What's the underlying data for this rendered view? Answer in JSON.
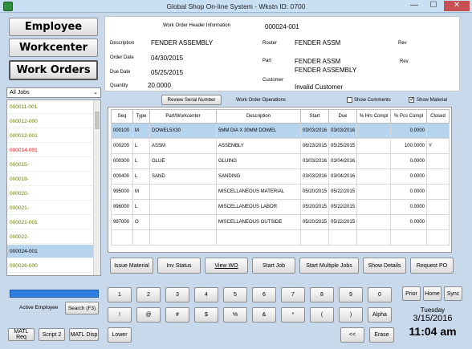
{
  "window": {
    "title": "Global Shop On-line System - Wkstn ID: 0700",
    "min": "—",
    "max": "☐",
    "close": "✕"
  },
  "nav": {
    "employee": "Employee",
    "workcenter": "Workcenter",
    "work_orders": "Work Orders"
  },
  "jobs": {
    "filter": "All Jobs",
    "items": [
      {
        "id": "000011-001",
        "color": "#6a7d00"
      },
      {
        "id": "000012-000",
        "color": "#6a7d00"
      },
      {
        "id": "000012-001",
        "color": "#6a7d00"
      },
      {
        "id": "000014-001",
        "color": "#d11a1a"
      },
      {
        "id": "000015-",
        "color": "#6a7d00"
      },
      {
        "id": "000019-",
        "color": "#6a7d00"
      },
      {
        "id": "000020-",
        "color": "#6a7d00"
      },
      {
        "id": "000021-",
        "color": "#6a7d00"
      },
      {
        "id": "000021-001",
        "color": "#6a7d00"
      },
      {
        "id": "000022-",
        "color": "#6a7d00"
      },
      {
        "id": "000024-001",
        "color": "#000000",
        "selected": true
      },
      {
        "id": "000026-000",
        "color": "#6a7d00"
      }
    ]
  },
  "header": {
    "section_label": "Work Order Header Information",
    "wo_number": "000024-001",
    "description_label": "Description",
    "description": "FENDER ASSEMBLY",
    "order_date_label": "Order Date",
    "order_date": "04/30/2015",
    "due_date_label": "Due Date",
    "due_date": "05/25/2015",
    "quantity_label": "Quantity",
    "quantity": "20.0000",
    "router_label": "Router",
    "router": "FENDER ASSM",
    "rev_label": "Rev",
    "part_label": "Part",
    "part_line1": "FENDER ASSM",
    "part_line2": "FENDER ASSEMBLY",
    "part_rev_label": "Rev",
    "customer_label": "Customer",
    "customer": "Invalid Customer"
  },
  "ops_toolbar": {
    "review_serial": "Review Serial Number",
    "ops_label": "Work Order Operations",
    "show_comments": "Show Comments",
    "show_comments_checked": false,
    "show_material": "Show Material",
    "show_material_checked": true
  },
  "operations": {
    "columns": [
      "Seq",
      "Type",
      "Part/Workcenter",
      "Description",
      "Start",
      "Due",
      "% Hrs Compl",
      "% Pcs Compl",
      "Closed"
    ],
    "rows": [
      {
        "seq": "000100",
        "type": "M",
        "part": "DOWEL5X30",
        "desc": "5MM DIA X 30MM DOWEL",
        "start": "03/03/2016",
        "due": "03/03/2016",
        "hrs": "",
        "pcs": "0.0000",
        "closed": "",
        "selected": true
      },
      {
        "seq": "000200",
        "type": "L",
        "part": "ASSM",
        "desc": "ASSEMBLY",
        "start": "06/23/2015",
        "due": "05/25/2015",
        "hrs": "",
        "pcs": "100.0000",
        "closed": "Y"
      },
      {
        "seq": "000300",
        "type": "L",
        "part": "GLUE",
        "desc": "GLUING",
        "start": "03/03/2016",
        "due": "03/04/2016",
        "hrs": "",
        "pcs": "0.0000",
        "closed": ""
      },
      {
        "seq": "000400",
        "type": "L",
        "part": "SAND",
        "desc": "SANDING",
        "start": "03/03/2016",
        "due": "03/04/2016",
        "hrs": "",
        "pcs": "0.0000",
        "closed": ""
      },
      {
        "seq": "995000",
        "type": "M",
        "part": "",
        "desc": "MISCELLANEOUS MATERIAL",
        "start": "05/20/2015",
        "due": "05/22/2015",
        "hrs": "",
        "pcs": "0.0000",
        "closed": ""
      },
      {
        "seq": "996000",
        "type": "L",
        "part": "",
        "desc": "MISCELLANEOUS LABOR",
        "start": "05/20/2015",
        "due": "05/22/2015",
        "hrs": "",
        "pcs": "0.0000",
        "closed": ""
      },
      {
        "seq": "997000",
        "type": "O",
        "part": "",
        "desc": "MISCELLANEOUS OUTSIDE",
        "start": "05/20/2015",
        "due": "05/22/2015",
        "hrs": "",
        "pcs": "0.0000",
        "closed": ""
      }
    ]
  },
  "actions": {
    "issue_material": "Issue Material",
    "inv_status": "Inv Status",
    "view_wo": "View WO",
    "start_job": "Start Job",
    "start_multiple": "Start Multiple Jobs",
    "show_details": "Show Details",
    "request_po": "Request PO"
  },
  "employee": {
    "active_label": "Active Employee",
    "search": "Search (F3)"
  },
  "bottom_left": {
    "matl_req": "MATL Req",
    "script2": "Script 2",
    "matl_disp": "MATL Disp"
  },
  "keypad": {
    "row1": [
      "1",
      "2",
      "3",
      "4",
      "5",
      "6",
      "7",
      "8",
      "9",
      "0"
    ],
    "row2": [
      "!",
      "@",
      "#",
      "$",
      "%",
      "&",
      "*",
      "(",
      ")",
      "Alpha"
    ],
    "lower": "Lower",
    "backspace": "<<",
    "erase": "Erase"
  },
  "nav_right": {
    "prior": "Prior",
    "home": "Home",
    "sync": "Sync"
  },
  "clock": {
    "day": "Tuesday",
    "date": "3/15/2016",
    "time": "11:04 am"
  }
}
